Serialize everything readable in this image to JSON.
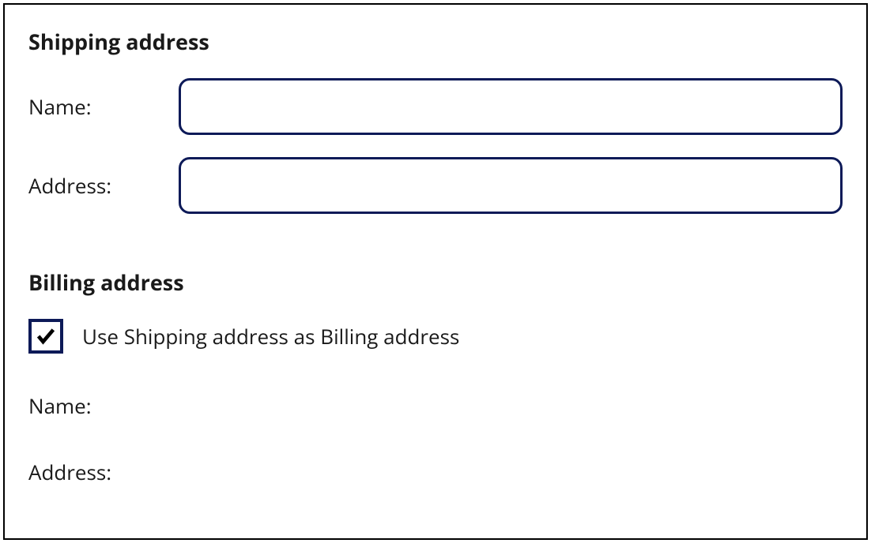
{
  "shipping": {
    "heading": "Shipping address",
    "nameLabel": "Name:",
    "nameValue": "",
    "addressLabel": "Address:",
    "addressValue": ""
  },
  "billing": {
    "heading": "Billing address",
    "useShippingLabel": "Use Shipping address as Billing address",
    "useShippingChecked": true,
    "nameLabel": "Name:",
    "addressLabel": "Address:"
  }
}
